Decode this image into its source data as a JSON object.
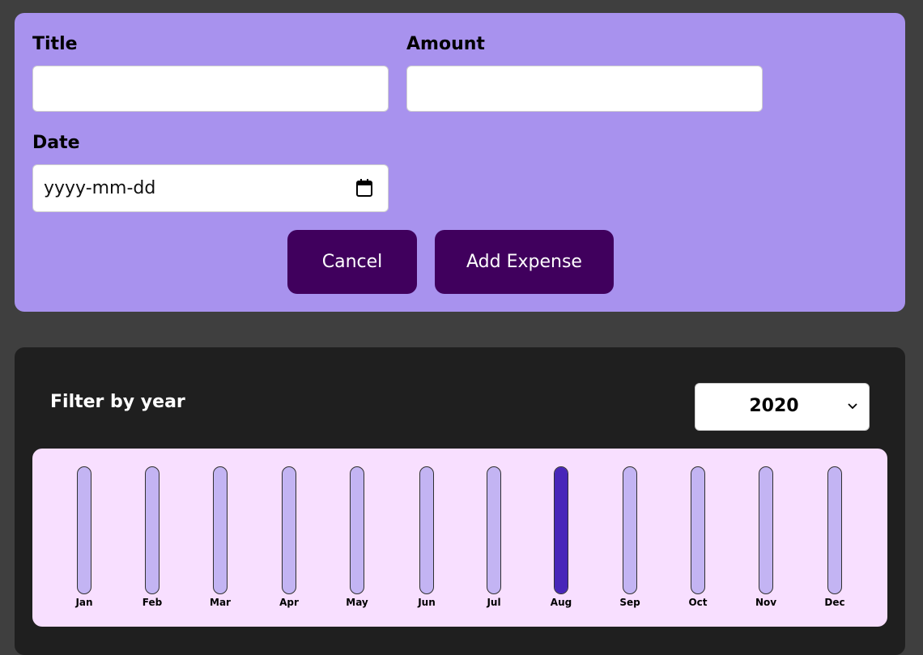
{
  "form": {
    "title_label": "Title",
    "title_value": "",
    "amount_label": "Amount",
    "amount_value": "",
    "date_label": "Date",
    "date_placeholder": "yyyy-mm-dd",
    "cancel_label": "Cancel",
    "submit_label": "Add Expense"
  },
  "filter": {
    "label": "Filter by year",
    "selected_year": "2020"
  },
  "colors": {
    "form_bg": "#a892ee",
    "button_bg": "#40005d",
    "chart_bg": "#f8dfff",
    "bar_empty": "#c3b4f3",
    "bar_fill": "#4826b9"
  },
  "chart_data": {
    "type": "bar",
    "categories": [
      "Jan",
      "Feb",
      "Mar",
      "Apr",
      "May",
      "Jun",
      "Jul",
      "Aug",
      "Sep",
      "Oct",
      "Nov",
      "Dec"
    ],
    "values": [
      0,
      0,
      0,
      0,
      0,
      0,
      0,
      1,
      0,
      0,
      0,
      0
    ],
    "ylim": [
      0,
      1
    ]
  }
}
